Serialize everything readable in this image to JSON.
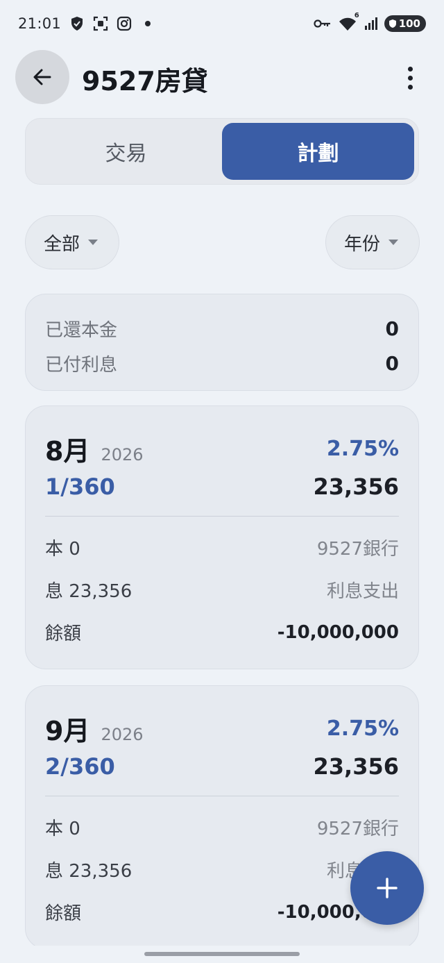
{
  "status_bar": {
    "time": "21:01",
    "left_icons": [
      "shield-icon",
      "screen-capture-icon",
      "instagram-icon",
      "dot-icon"
    ],
    "right_icons": [
      "key-icon",
      "wifi-icon",
      "signal-icon"
    ],
    "wifi_badge": "6",
    "battery_level": "100"
  },
  "app_bar": {
    "title": "9527房貸"
  },
  "tabs": [
    {
      "label": "交易",
      "active": false
    },
    {
      "label": "計劃",
      "active": true
    }
  ],
  "filters": {
    "category": "全部",
    "period": "年份"
  },
  "summary": {
    "principal_paid_label": "已還本金",
    "principal_paid_value": "0",
    "interest_paid_label": "已付利息",
    "interest_paid_value": "0"
  },
  "plans": [
    {
      "month": "8月",
      "year": "2026",
      "rate": "2.75%",
      "period": "1/360",
      "payment": "23,356",
      "principal": "本 0",
      "account": "9527銀行",
      "interest": "息 23,356",
      "category": "利息支出",
      "balance_label": "餘額",
      "balance": "-10,000,000"
    },
    {
      "month": "9月",
      "year": "2026",
      "rate": "2.75%",
      "period": "2/360",
      "payment": "23,356",
      "principal": "本 0",
      "account": "9527銀行",
      "interest": "息 23,356",
      "category": "利息支出",
      "balance_label": "餘額",
      "balance": "-10,000,000"
    }
  ],
  "fab": {
    "icon": "plus-icon"
  },
  "colors": {
    "accent": "#3a5da6",
    "background": "#eef2f7",
    "card": "#e6eaf0"
  }
}
